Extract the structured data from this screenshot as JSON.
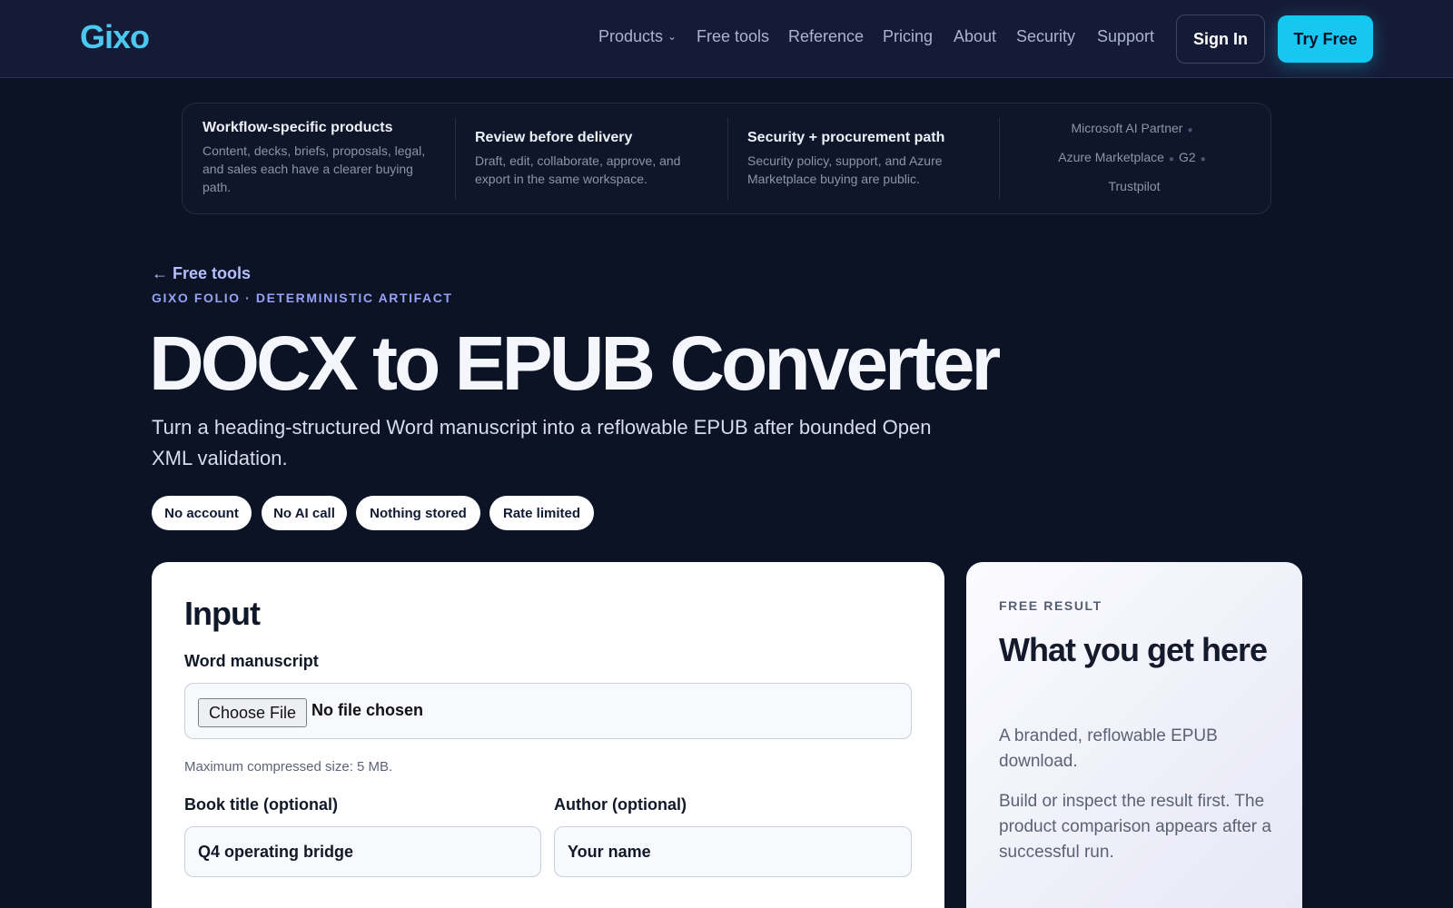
{
  "header": {
    "logo": "Gixo",
    "nav": [
      {
        "label": "Products",
        "has_dropdown": true
      },
      {
        "label": "Free tools"
      },
      {
        "label": "Reference"
      },
      {
        "label": "Pricing"
      },
      {
        "label": "About"
      },
      {
        "label": "Security"
      },
      {
        "label": "Support"
      }
    ],
    "sign_in": "Sign In",
    "try_free": "Try Free"
  },
  "trust_strip": {
    "columns": [
      {
        "title": "Workflow-specific products",
        "text": "Content, decks, briefs, proposals, legal, and sales each have a clearer buying path."
      },
      {
        "title": "Review before delivery",
        "text": "Draft, edit, collaborate, approve, and export in the same workspace."
      },
      {
        "title": "Security + procurement path",
        "text": "Security policy, support, and Azure Marketplace buying are public."
      }
    ],
    "partners": [
      "Microsoft AI Partner",
      "Azure Marketplace",
      "G2",
      "Trustpilot"
    ]
  },
  "hero": {
    "back_link": "← Free tools",
    "eyebrow": "GIXO FOLIO · DETERMINISTIC ARTIFACT",
    "title": "DOCX to EPUB Converter",
    "subtitle": "Turn a heading-structured Word manuscript into a reflowable EPUB after bounded Open XML validation.",
    "chips": [
      "No account",
      "No AI call",
      "Nothing stored",
      "Rate limited"
    ]
  },
  "input_card": {
    "heading": "Input",
    "manuscript_label": "Word manuscript",
    "file_button": "Choose File",
    "file_status": "No file chosen",
    "size_hint": "Maximum compressed size: 5 MB.",
    "title_label": "Book title (optional)",
    "title_placeholder": "Q4 operating bridge",
    "author_label": "Author (optional)",
    "author_placeholder": "Your name"
  },
  "result_card": {
    "eyebrow": "FREE RESULT",
    "title": "What you get here",
    "p1": "A branded, reflowable EPUB download.",
    "p2": "Build or inspect the result first. The product comparison appears after a successful run."
  },
  "colors": {
    "background": "#0c1324",
    "header": "#151b36",
    "accent": "#17c7f1",
    "logo": "#4cc7ee",
    "link": "#b4bfff"
  }
}
